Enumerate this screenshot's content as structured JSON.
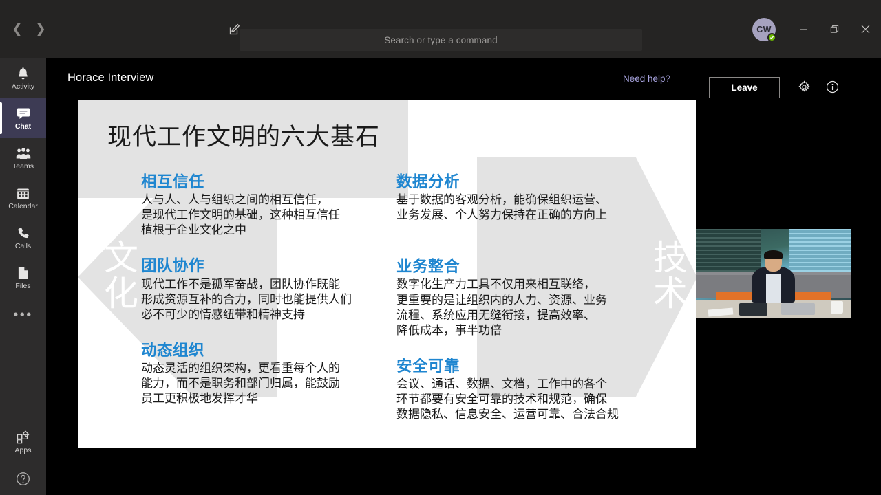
{
  "titlebar": {
    "back_icon": "chevron-left-icon",
    "forward_icon": "chevron-right-icon",
    "compose_icon": "compose-new-chat-icon",
    "search_placeholder": "Search or type a command",
    "avatar_initials": "CW",
    "presence_status": "available",
    "minimize_label": "—",
    "restore_label": "restore",
    "close_label": "×",
    "background": "#252423"
  },
  "rail": {
    "items": [
      {
        "label": "Activity",
        "icon": "bell-icon",
        "selected": false
      },
      {
        "label": "Chat",
        "icon": "chat-bubble-icon",
        "selected": true
      },
      {
        "label": "Teams",
        "icon": "teams-people-icon",
        "selected": false
      },
      {
        "label": "Calendar",
        "icon": "calendar-icon",
        "selected": false
      },
      {
        "label": "Calls",
        "icon": "phone-icon",
        "selected": false
      },
      {
        "label": "Files",
        "icon": "file-icon",
        "selected": false
      }
    ],
    "more_label": "•••",
    "apps_label": "Apps",
    "apps_icon": "apps-grid-icon",
    "help_icon": "help-question-icon",
    "selected_color": "#3d3b54",
    "background": "#2d2c2c"
  },
  "meeting": {
    "title": "Horace Interview",
    "need_help_label": "Need help?",
    "need_help_color": "#a6a2dd",
    "leave_label": "Leave",
    "settings_icon": "gear-icon",
    "info_icon": "info-circle-icon"
  },
  "slide": {
    "title": "现代工作文明的六大基石",
    "heading_color": "#1f86d0",
    "watermark_left": "文化",
    "watermark_right": "技术",
    "left_column": [
      {
        "heading": "相互信任",
        "body": "人与人、人与组织之间的相互信任，\n是现代工作文明的基础，这种相互信任\n植根于企业文化之中"
      },
      {
        "heading": "团队协作",
        "body": "现代工作不是孤军奋战，团队协作既能\n形成资源互补的合力，同时也能提供人们\n必不可少的情感纽带和精神支持"
      },
      {
        "heading": "动态组织",
        "body": "动态灵活的组织架构，更看重每个人的\n能力，而不是职务和部门归属，能鼓励\n员工更积极地发挥才华"
      }
    ],
    "right_column": [
      {
        "heading": "数据分析",
        "body": "基于数据的客观分析，能确保组织运营、\n业务发展、个人努力保持在正确的方向上"
      },
      {
        "heading": "业务整合",
        "body": "数字化生产力工具不仅用来相互联络，\n更重要的是让组织内的人力、资源、业务\n流程、系统应用无缝衔接，提高效率、\n降低成本，事半功倍"
      },
      {
        "heading": "安全可靠",
        "body": "会议、通话、数据、文档，工作中的各个\n环节都要有安全可靠的技术和规范，确保\n数据隐私、信息安全、运营可靠、合法合规"
      }
    ]
  },
  "video_tile": {
    "name": "self-video-feed",
    "description": "presenter video"
  }
}
